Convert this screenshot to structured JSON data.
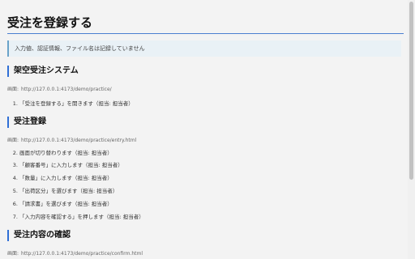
{
  "page": {
    "title": "受注を登録する",
    "notice": "入力値、認証情報、ファイル名は記録していません"
  },
  "screen_label": "画面:",
  "sections": [
    {
      "heading": "架空受注システム",
      "url": "http://127.0.0.1:4173/demo/practice/",
      "steps": [
        {
          "num": "1.",
          "text": "「受注を登録する」を開きます（担当: 担当者）"
        }
      ]
    },
    {
      "heading": "受注登録",
      "url": "http://127.0.0.1:4173/demo/practice/entry.html",
      "steps": [
        {
          "num": "2.",
          "text": "画面が切り替わります（担当: 担当者）"
        },
        {
          "num": "3.",
          "text": "「顧客番号」に入力します（担当: 担当者）"
        },
        {
          "num": "4.",
          "text": "「数量」に入力します（担当: 担当者）"
        },
        {
          "num": "5.",
          "text": "「出荷区分」を選びます（担当: 担当者）"
        },
        {
          "num": "6.",
          "text": "「請求書」を選びます（担当: 担当者）"
        },
        {
          "num": "7.",
          "text": "「入力内容を確認する」を押します（担当: 担当者）"
        }
      ]
    },
    {
      "heading": "受注内容の確認",
      "url": "http://127.0.0.1:4173/demo/practice/confirm.html",
      "steps": []
    }
  ]
}
